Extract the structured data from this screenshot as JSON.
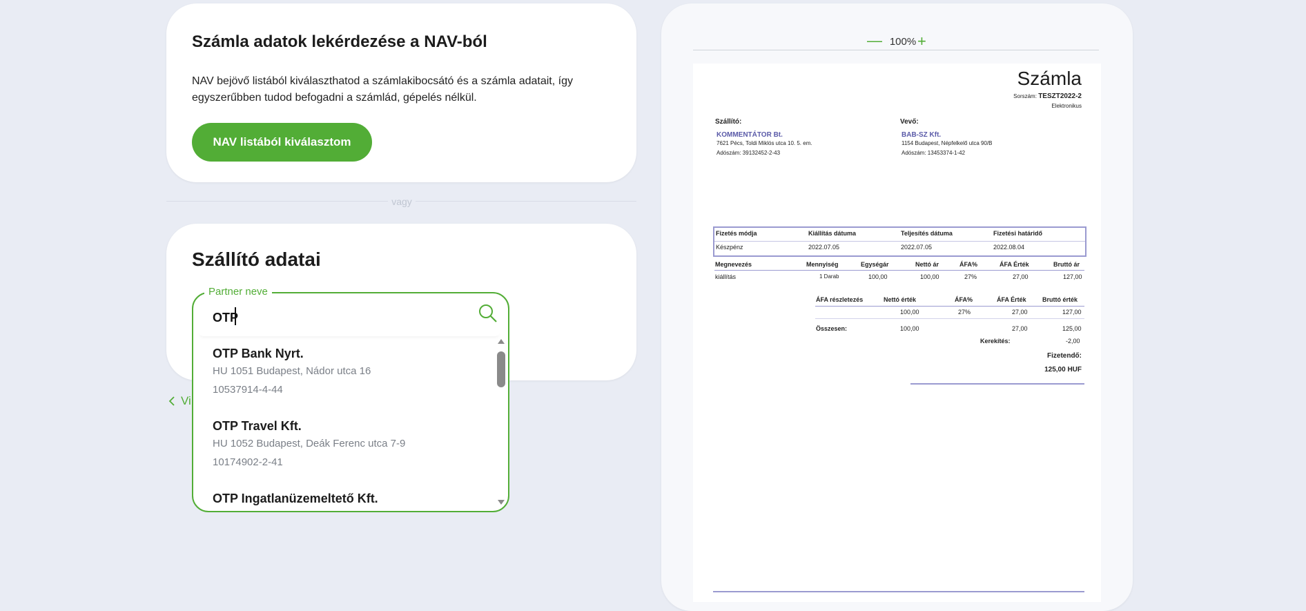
{
  "nav_card": {
    "title": "Számla adatok lekérdezése a NAV-ból",
    "description": "NAV bejövő listából kiválaszthatod a számlakibocsátó és a számla adatait, így egyszerűbben tudod befogadni a számlád, gépelés nélkül.",
    "button_label": "NAV listából kiválasztom"
  },
  "divider": {
    "label": "vagy"
  },
  "supplier_card": {
    "title": "Szállító adatai",
    "back_label": "Vi"
  },
  "partner_search": {
    "legend": "Partner neve",
    "value": "OTP",
    "results": [
      {
        "name": "OTP Bank Nyrt.",
        "address": "HU 1051 Budapest, Nádor utca 16",
        "tax_number": "10537914-4-44"
      },
      {
        "name": "OTP Travel Kft.",
        "address": "HU 1052 Budapest, Deák Ferenc utca 7-9",
        "tax_number": "10174902-2-41"
      },
      {
        "name": "OTP Ingatlanüzemeltető Kft.",
        "address": "",
        "tax_number": ""
      }
    ]
  },
  "preview": {
    "zoom_minus": "—",
    "zoom": "100%",
    "zoom_plus": "+"
  },
  "invoice": {
    "title": "Számla",
    "serial_label": "Sorszám:",
    "serial": "TESZT2022-2",
    "type": "Elektronikus",
    "seller_label": "Szállító:",
    "seller_name": "KOMMENTÁTOR Bt.",
    "seller_address": "7621 Pécs, Toldi Miklós utca 10. 5. em.",
    "seller_tax": "Adószám: 39132452-2-43",
    "buyer_label": "Vevő:",
    "buyer_name": "BAB-SZ Kft.",
    "buyer_address": "1154 Budapest, Népfelkelő utca 90/B",
    "buyer_tax": "Adószám: 13453374-1-42",
    "payment_headers": [
      "Fizetés módja",
      "Kiállítás dátuma",
      "Teljesítés dátuma",
      "Fizetési határidő"
    ],
    "payment_values": [
      "Készpénz",
      "2022.07.05",
      "2022.07.05",
      "2022.08.04"
    ],
    "item_headers": [
      "Megnevezés",
      "Mennyiség",
      "Egységár",
      "Nettó ár",
      "ÁFA%",
      "ÁFA Érték",
      "Bruttó ár"
    ],
    "item_values": [
      "kiállítás",
      "1 Darab",
      "100,00",
      "100,00",
      "27%",
      "27,00",
      "127,00"
    ],
    "vat_headers": [
      "ÁFA részletezés",
      "Nettó érték",
      "ÁFA%",
      "ÁFA Érték",
      "Bruttó érték"
    ],
    "vat_values": [
      "",
      "100,00",
      "27%",
      "27,00",
      "127,00"
    ],
    "total_label": "Összesen:",
    "total_values": [
      "100,00",
      "",
      "27,00",
      "125,00"
    ],
    "rounding_label": "Kerekítés:",
    "rounding_value": "-2,00",
    "payable_label": "Fizetendő:",
    "payable_value": "125,00 HUF"
  },
  "colors": {
    "accent": "#52ad36",
    "background": "#e9ecf4",
    "invoice_accent": "#5a5aa8"
  }
}
